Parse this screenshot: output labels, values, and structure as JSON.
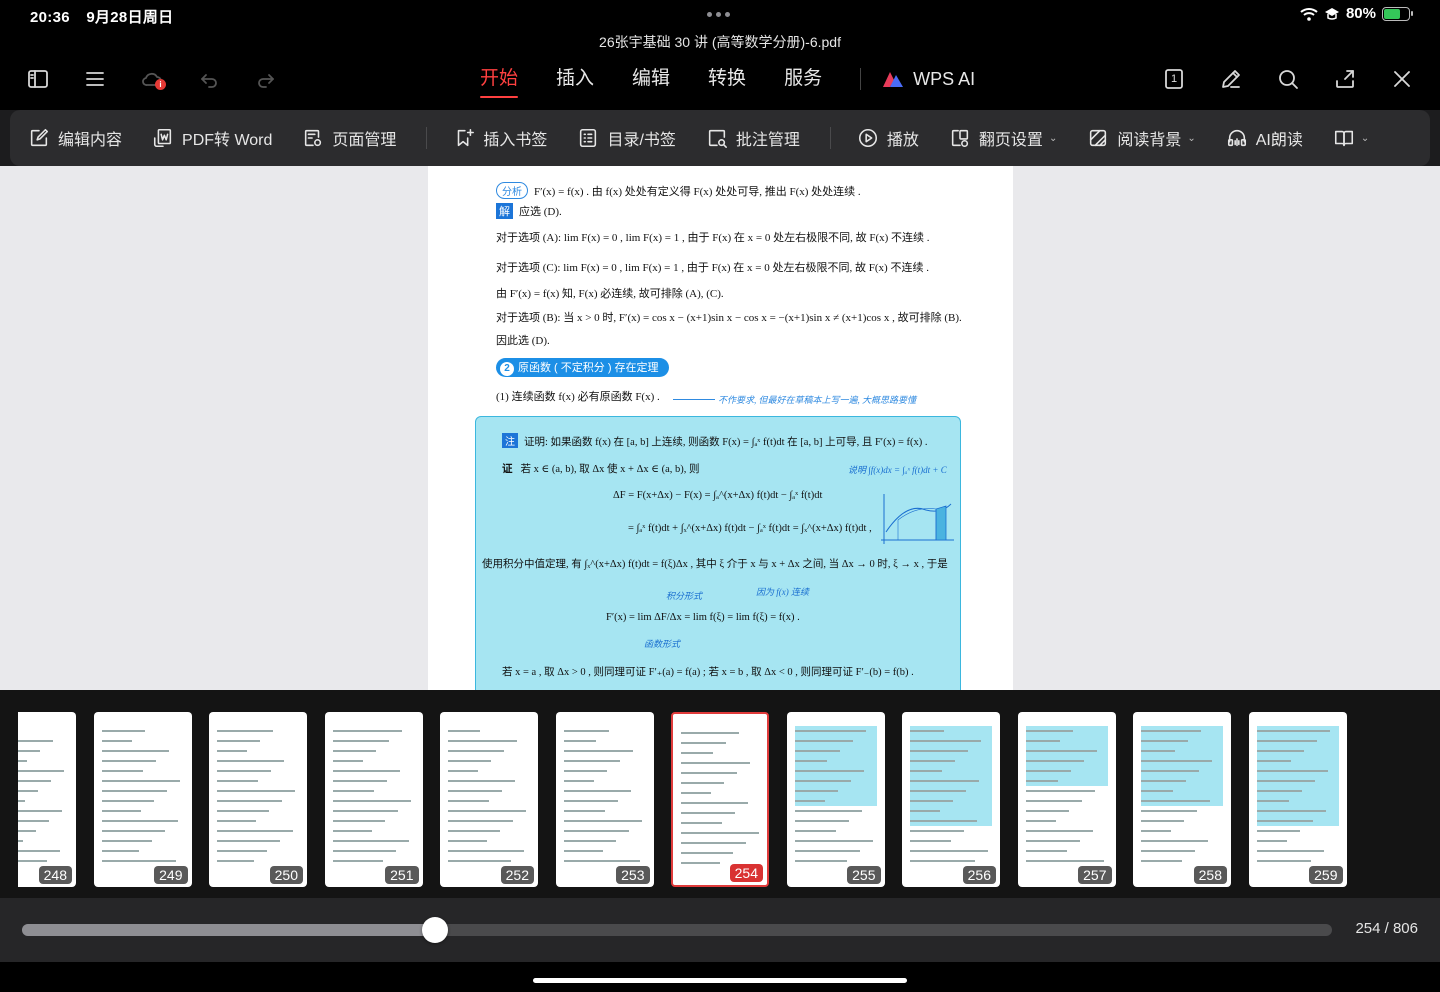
{
  "status": {
    "time": "20:36",
    "date": "9月28日周日",
    "battery_pct": "80%",
    "battery_color": "#34c759"
  },
  "doc": {
    "title": "26张宇基础 30 讲 (高等数学分册)-6.pdf"
  },
  "toolbar": {
    "icons": [
      "sidebar-icon",
      "menu-icon",
      "cloud-alert-icon",
      "undo-icon",
      "redo-icon",
      "page-view-icon",
      "pen-icon",
      "search-icon",
      "share-icon",
      "close-icon"
    ],
    "tabs": [
      {
        "label": "开始",
        "active": true
      },
      {
        "label": "插入",
        "active": false
      },
      {
        "label": "编辑",
        "active": false
      },
      {
        "label": "转换",
        "active": false
      },
      {
        "label": "服务",
        "active": false
      }
    ],
    "wps_ai": "WPS AI",
    "page_view_num": "1",
    "accent": "#ff4040"
  },
  "ribbon": {
    "edit_content": "编辑内容",
    "pdf_to_word": "PDF转 Word",
    "page_manage": "页面管理",
    "insert_bookmark": "插入书签",
    "toc_bookmark": "目录/书签",
    "annotation_manage": "批注管理",
    "play": "播放",
    "page_turn_settings": "翻页设置",
    "reading_bg": "阅读背景",
    "ai_read": "AI朗读"
  },
  "page_content": {
    "analysis_badge": "分析",
    "analysis_text": "F′(x) = f(x) . 由 f(x) 处处有定义得 F(x) 处处可导, 推出 F(x) 处处连续 .",
    "solve_badge": "解",
    "solve_text": "应选 (D).",
    "line_a": "对于选项 (A): lim F(x) = 0 , lim F(x) = 1 , 由于 F(x) 在 x = 0 处左右极限不同, 故 F(x) 不连续 .",
    "line_c": "对于选项 (C): lim F(x) = 0 , lim F(x) = 1 , 由于 F(x) 在 x = 0 处左右极限不同, 故 F(x) 不连续 .",
    "line_f": "由 F′(x) = f(x) 知, F(x) 必连续, 故可排除 (A), (C).",
    "line_b": "对于选项 (B): 当 x > 0 时, F′(x) = cos x − (x+1)sin x − cos x = −(x+1)sin x ≠ (x+1)cos x , 故可排除 (B).",
    "line_d": "因此选 (D).",
    "section_num": "2",
    "section_title": "原函数 ( 不定积分 ) 存在定理",
    "theorem_1": "(1) 连续函数 f(x) 必有原函数 F(x) .",
    "hand_note": "不作要求, 但最好在草稿本上写一遍, 大概思路要懂",
    "note_tag": "注",
    "box_line1": "证明: 如果函数 f(x) 在 [a, b] 上连续, 则函数 F(x) = ∫ₐˣ f(t)dt 在 [a, b] 上可导, 且 F′(x) = f(x) .",
    "proof_tag": "证",
    "box_line2": "若 x ∈ (a, b), 取 Δx 使 x + Δx ∈ (a, b), 则",
    "side_note_1": "说明 ∫f(x)dx = ∫ₐˣ f(t)dt + C",
    "box_line3": "ΔF = F(x+Δx) − F(x) = ∫ₐ^(x+Δx) f(t)dt − ∫ₐˣ f(t)dt",
    "box_line4": "= ∫ₐˣ f(t)dt + ∫ₓ^(x+Δx) f(t)dt − ∫ₐˣ f(t)dt = ∫ₓ^(x+Δx) f(t)dt ,",
    "box_line5": "使用积分中值定理, 有 ∫ₓ^(x+Δx) f(t)dt = f(ξ)Δx , 其中 ξ 介于 x 与 x + Δx 之间, 当 Δx → 0 时, ξ → x , 于是",
    "side_note_2": "积分形式",
    "side_note_3": "因为 f(x) 连续",
    "box_line6": "F′(x) = lim ΔF/Δx = lim f(ξ) = lim f(ξ) = f(x) .",
    "side_note_4": "函数形式",
    "box_line7": "若 x = a , 取 Δx > 0 , 则同理可证 F′₊(a) = f(a) ; 若 x = b , 取 Δx < 0 , 则同理可证 F′₋(b) = f(b) ."
  },
  "thumbnails": {
    "pages": [
      "248",
      "249",
      "250",
      "251",
      "252",
      "253",
      "254",
      "255",
      "256",
      "257",
      "258",
      "259"
    ],
    "active_page": "254"
  },
  "slider": {
    "progress": 0.315,
    "page_count": "254 / 806"
  }
}
